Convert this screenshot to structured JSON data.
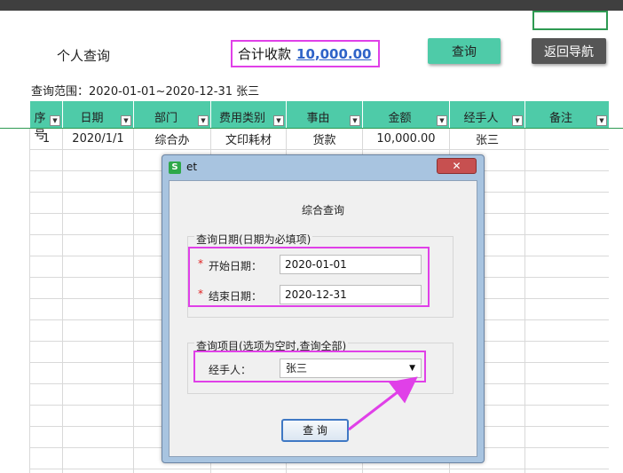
{
  "sheet": {
    "title": "个人查询",
    "total_label": "合计收款",
    "total_value": "10,000.00",
    "query_button": "查询",
    "nav_button": "返回导航",
    "range_text": "查询范围：2020-01-01~2020-12-31 张三",
    "columns": [
      "序号",
      "日期",
      "部门",
      "费用类别",
      "事由",
      "金额",
      "经手人",
      "备注"
    ],
    "rows": [
      [
        "1",
        "2020/1/1",
        "综合办",
        "文印耗材",
        "货款",
        "10,000.00",
        "张三",
        ""
      ]
    ],
    "dropdown_icon": "▼"
  },
  "dialog": {
    "title": "et",
    "app_icon_glyph": "S",
    "close_glyph": "✕",
    "heading": "综合查询",
    "date_group_label": "查询日期(日期为必填项)",
    "required_mark": "*",
    "start_label": "开始日期：",
    "start_value": "2020-01-01",
    "end_label": "结束日期：",
    "end_value": "2020-12-31",
    "item_group_label": "查询项目(选项为空时,查询全部)",
    "handler_label": "经手人：",
    "handler_value": "张三",
    "select_arrow": "▼",
    "submit_label": "查 询"
  },
  "colors": {
    "header_green": "#4ecba8",
    "highlight_magenta": "#e040e8",
    "total_blue": "#2f63c8",
    "nav_gray": "#555555"
  }
}
